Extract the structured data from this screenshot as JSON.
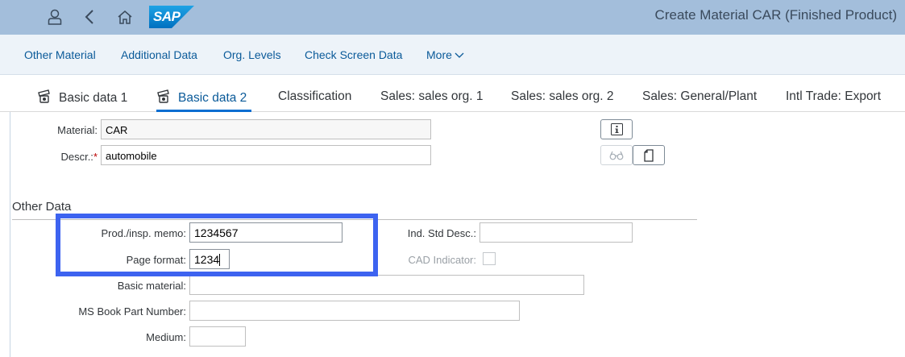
{
  "shell": {
    "title": "Create Material CAR (Finished Product)",
    "logo_text": "SAP",
    "icons": [
      "user-icon",
      "back-icon",
      "home-icon"
    ]
  },
  "toolbar": {
    "items": [
      "Other Material",
      "Additional Data",
      "Org. Levels",
      "Check Screen Data",
      "More"
    ]
  },
  "tabs": {
    "items": [
      "Basic data 1",
      "Basic data 2",
      "Classification",
      "Sales: sales org. 1",
      "Sales: sales org. 2",
      "Sales: General/Plant",
      "Intl Trade: Export"
    ],
    "active": "Basic data 2"
  },
  "header_form": {
    "material_label": "Material:",
    "material_value": "CAR",
    "descr_label": "Descr.:",
    "descr_required": "*",
    "descr_value": "automobile"
  },
  "other_data": {
    "title": "Other Data",
    "prod_insp_memo_label": "Prod./insp. memo:",
    "prod_insp_memo_value": "1234567",
    "page_format_label": "Page format:",
    "page_format_value": "1234",
    "ind_std_desc_label": "Ind. Std Desc.:",
    "ind_std_desc_value": "",
    "cad_indicator_label": "CAD Indicator:",
    "basic_material_label": "Basic material:",
    "basic_material_value": "",
    "ms_book_part_label": "MS Book Part Number:",
    "ms_book_part_value": "",
    "medium_label": "Medium:",
    "medium_value": ""
  },
  "colors": {
    "shell_bg": "#a3bedb",
    "toolbar_bg": "#edf3f9",
    "link": "#0a5a99",
    "active_tab_underline": "#0a6ed1",
    "highlight_box": "#3d63f0",
    "required_star": "#bb0000"
  }
}
